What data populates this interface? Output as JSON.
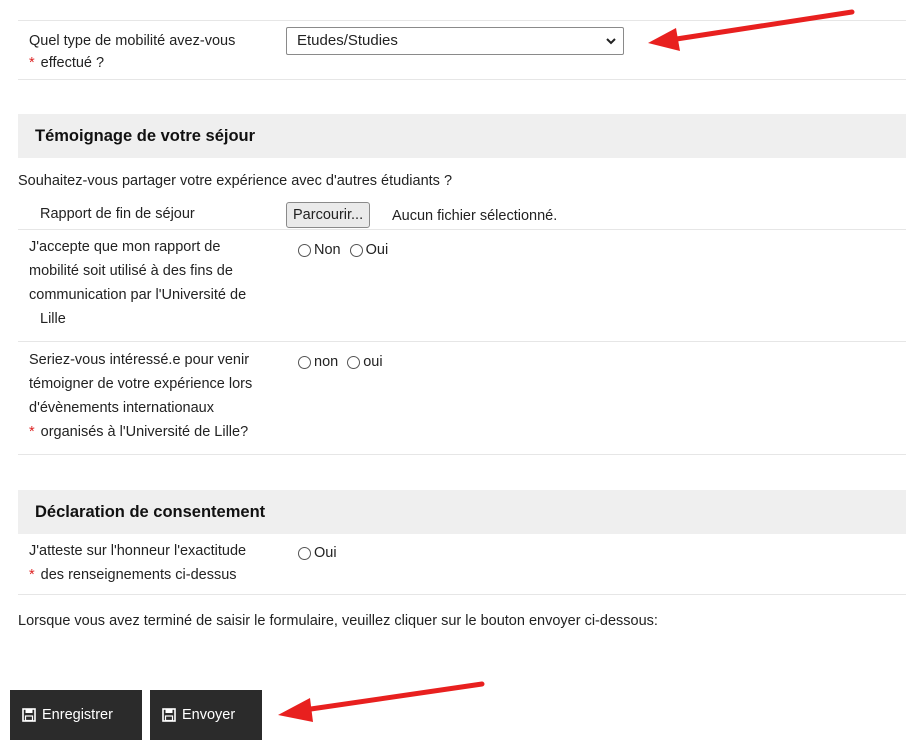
{
  "mobility": {
    "label_line1": "Quel type de mobilité avez-vous",
    "label_line2": "effectué ?",
    "required_mark": "*",
    "selected_value": "Etudes/Studies"
  },
  "testimony": {
    "heading": "Témoignage de votre séjour",
    "intro": "Souhaitez-vous partager votre expérience avec d'autres étudiants ?",
    "report_label": "Rapport de fin de séjour",
    "browse_button": "Parcourir...",
    "no_file": "Aucun fichier sélectionné.",
    "consent_lines": [
      "J'accepte que mon rapport de",
      "mobilité soit utilisé à des fins de",
      "communication par l'Université de",
      "Lille"
    ],
    "consent_options": [
      "Non",
      "Oui"
    ],
    "interest_lines": [
      "Seriez-vous intéressé.e pour venir",
      "témoigner de votre expérience lors",
      "d'évènements internationaux",
      "organisés à l'Université de Lille?"
    ],
    "interest_options": [
      "non",
      "oui"
    ],
    "required_mark": "*"
  },
  "declaration": {
    "heading": "Déclaration de consentement",
    "line1": "J'atteste sur l'honneur l'exactitude",
    "line2": "des renseignements ci-dessus",
    "required_mark": "*",
    "option": "Oui"
  },
  "footer_text": "Lorsque vous avez terminé de saisir le formulaire, veuillez cliquer sur le bouton envoyer ci-dessous:",
  "buttons": {
    "save": "Enregistrer",
    "submit": "Envoyer"
  },
  "colors": {
    "arrow": "#e8201f",
    "required": "#dd2222",
    "button_bg": "#2b2b2b",
    "section_bg": "#efefef"
  }
}
